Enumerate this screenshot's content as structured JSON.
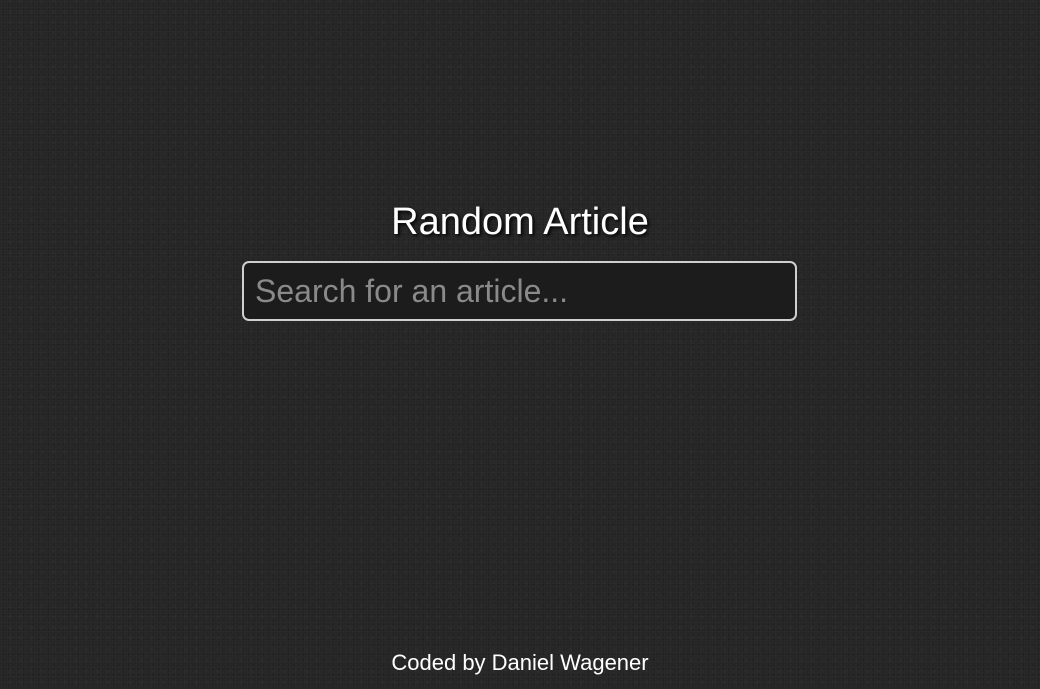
{
  "page": {
    "title": "Random Article",
    "background_color": "#262626"
  },
  "search": {
    "value": "",
    "placeholder": "Search for an article...",
    "border_color": "#cfcfcf",
    "background_color": "#1c1c1c"
  },
  "footer": {
    "credit": "Coded by Daniel Wagener"
  }
}
